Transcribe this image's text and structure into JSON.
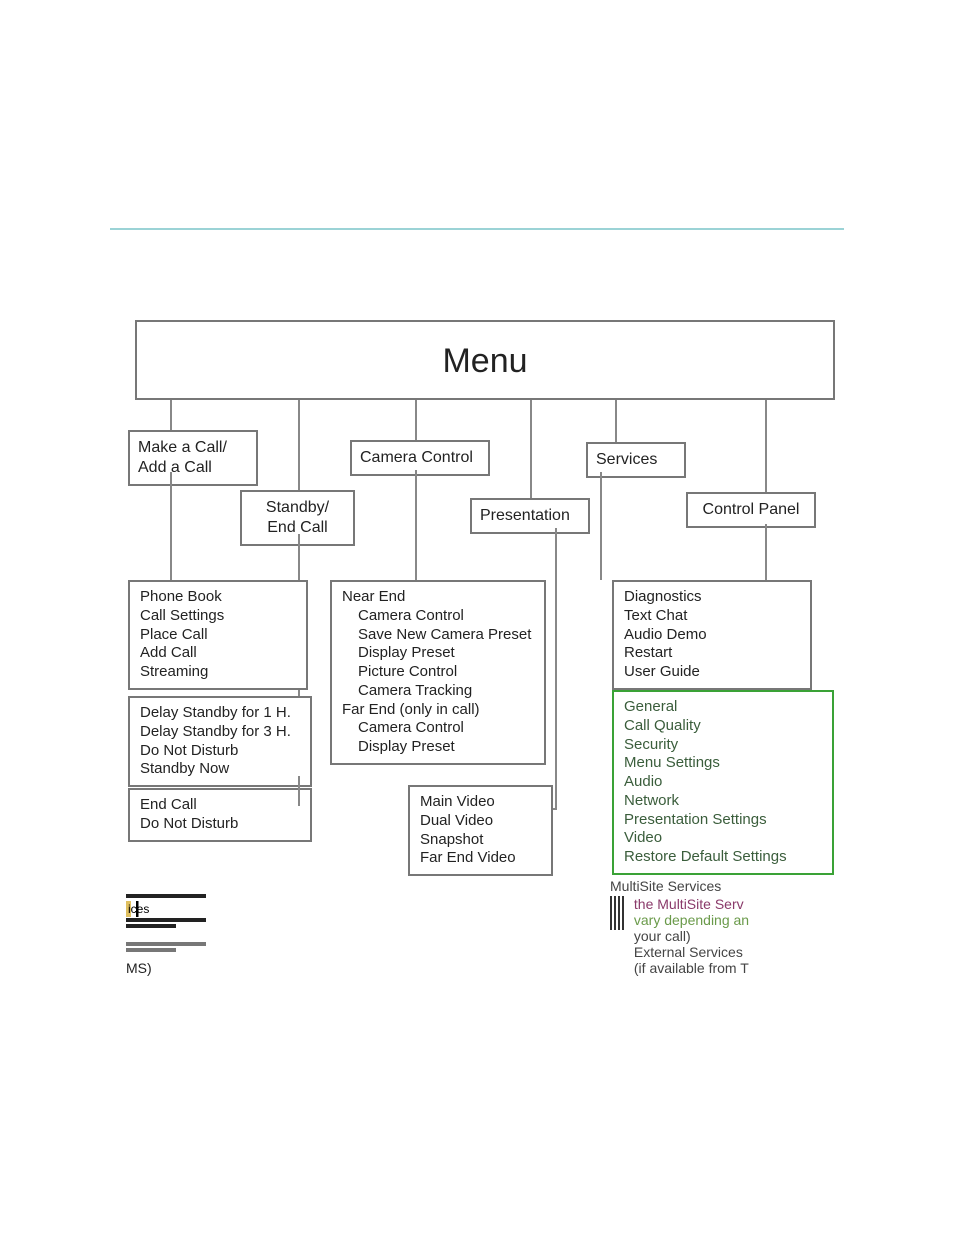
{
  "menu_title": "Menu",
  "categories": {
    "make_call": "Make a Call/\nAdd a Call",
    "standby": "Standby/\nEnd Call",
    "camera": "Camera Control",
    "presentation": "Presentation",
    "services": "Services",
    "control_panel": "Control Panel"
  },
  "groups": {
    "make_call_sub": [
      "Phone Book",
      "Call Settings",
      "Place Call",
      "Add Call",
      "Streaming"
    ],
    "standby_sub_a": [
      "Delay Standby for 1 H.",
      "Delay Standby for 3 H.",
      "Do Not Disturb",
      "Standby Now"
    ],
    "standby_sub_b": [
      "End Call",
      "Do Not Disturb"
    ],
    "camera_sub": {
      "near_end": "Near End",
      "near_items": [
        "Camera Control",
        "Save New Camera Preset",
        "Display Preset",
        "Picture Control",
        "Camera Tracking"
      ],
      "far_end": "Far End (only in call)",
      "far_items": [
        "Camera Control",
        "Display Preset"
      ]
    },
    "presentation_sub": [
      "Main Video",
      "Dual Video",
      "Snapshot",
      "Far End Video"
    ],
    "services_sub": [
      "Diagnostics",
      "Text Chat",
      "Audio Demo",
      "Restart",
      "User Guide"
    ],
    "control_panel_sub": [
      "General",
      "Call Quality",
      "Security",
      "Menu Settings",
      "Audio",
      "Network",
      "Presentation Settings",
      "Video",
      "Restore Default Settings"
    ]
  },
  "artifacts": {
    "left_ices": "ices",
    "left_ms": "MS)",
    "right_l0": "MultiSite Services",
    "right_l1": "the MultiSite Serv",
    "right_l2": "vary depending an",
    "right_l3": "your call)",
    "right_l4": "External Services",
    "right_l5": "(if available from T"
  }
}
